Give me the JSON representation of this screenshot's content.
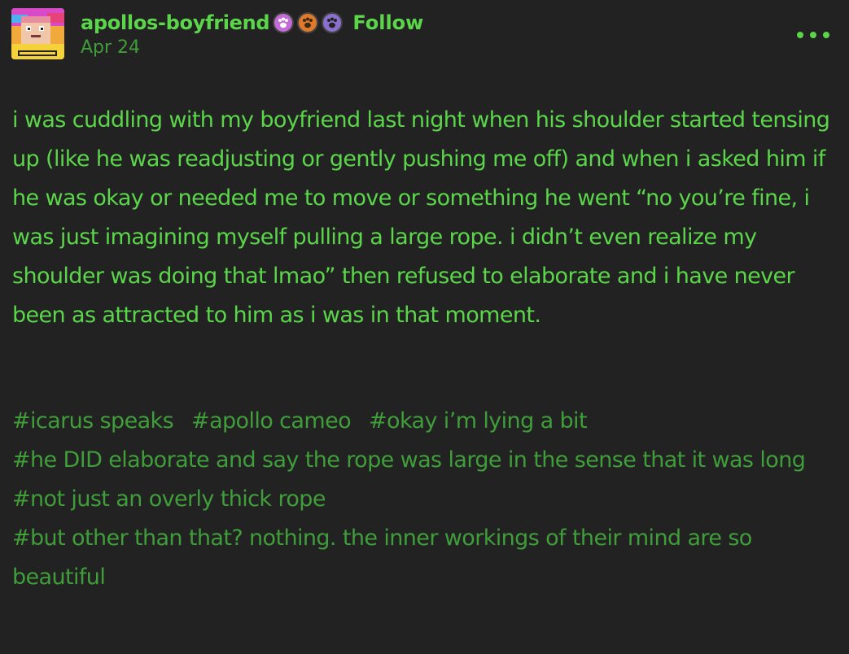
{
  "post": {
    "blog_name": "apollos-boyfriend",
    "follow_label": "Follow",
    "date": "Apr 24",
    "badges": [
      {
        "icon": "paw-icon",
        "color": "#c46bd6",
        "glyph": "🐾"
      },
      {
        "icon": "paw-icon",
        "color": "#e07a2a",
        "glyph": "🐾"
      },
      {
        "icon": "paw-icon",
        "color": "#8a6fcf",
        "glyph": "🐾"
      }
    ],
    "more_icon": "more-options-icon",
    "body": "i was cuddling with my boyfriend last night when his shoulder started tensing up (like he was readjusting or gently pushing me off) and when i asked him if he was okay or needed me to move or something he went “no you’re fine, i was just imagining myself pulling a large rope. i didn’t even realize my shoulder was doing that lmao” then refused to elaborate and i have never been as attracted to him as i was in that moment.",
    "tags": {
      "tag1": "#icarus speaks",
      "tag2": "#apollo cameo",
      "tag3": "#okay i’m lying a bit",
      "tag4": "#he DID elaborate and say the rope was large in the sense that it was long",
      "tag5": "#not just an overly thick rope",
      "tag6": "#but other than that? nothing. the inner workings of their mind are so beautiful"
    }
  },
  "colors": {
    "background": "#222222",
    "text_primary": "#5bd64a",
    "text_secondary": "#3f9e3a"
  }
}
